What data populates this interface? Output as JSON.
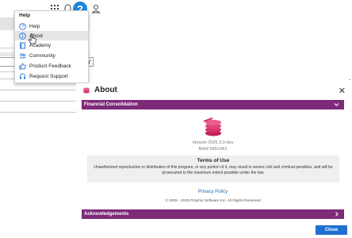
{
  "help_menu": {
    "header": "Help",
    "items": [
      {
        "label": "Help",
        "icon": "help-circle-icon"
      },
      {
        "label": "About",
        "icon": "info-icon"
      },
      {
        "label": "Academy",
        "icon": "book-icon"
      },
      {
        "label": "Community",
        "icon": "people-icon"
      },
      {
        "label": "Product Feedback",
        "icon": "thumbs-up-icon"
      },
      {
        "label": "Request Support",
        "icon": "headset-icon"
      }
    ]
  },
  "topbar": {
    "help_badge": "?"
  },
  "background": {
    "filter_glyph": "Y"
  },
  "dialog": {
    "title": "About",
    "close_glyph": "✕",
    "section_financial": "Financial Consolidation",
    "section_acknowledgements": "Acknowledgements",
    "version": "Version 2025.3.0-dev",
    "build": "Build 5d6ccfb1",
    "terms_title": "Terms of Use",
    "terms_body": "Unauthorized reproduction or distribution of this program, or any portion of it, may result in severe civil and criminal penalties, and will be prosecuted to the maximum extent possible under the law.",
    "privacy_link": "Privacy Policy",
    "copyright": "© 2005 - 2025 Prophix Software Inc. All Rights Reserved",
    "close_button": "Close"
  },
  "colors": {
    "accent": "#7d2a79",
    "logo": "#d6336c",
    "primary": "#1f6fd1",
    "help_badge": "#1f84d6"
  }
}
